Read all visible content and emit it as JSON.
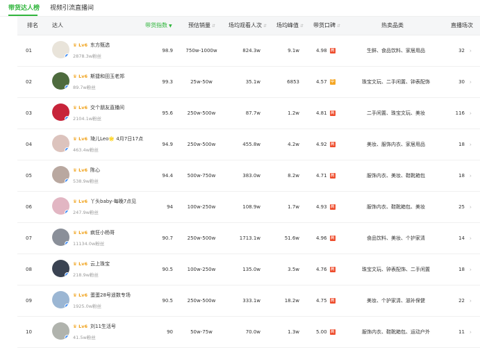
{
  "tabs": [
    {
      "label": "带货达人榜",
      "active": true
    },
    {
      "label": "视频引流直播间",
      "active": false
    }
  ],
  "colors": {
    "accent": "#2fb53b",
    "lv_badge": "#f0a21b",
    "grade_high": "#ee4d2d",
    "grade_mid": "#f5a623",
    "verified_badge": "#3d8df7"
  },
  "headers": {
    "rank": "排名",
    "name": "达人",
    "index": "带货指数",
    "sales": "预估销量",
    "viewers": "场均观看人次",
    "peak": "场均峰值",
    "rating": "带货口碑",
    "category": "热卖品类",
    "sessions": "直播场次"
  },
  "rows": [
    {
      "rank": "01",
      "name": "东方甄选",
      "level": "Lv6",
      "fans": "2878.3w粉丝",
      "index": "98.9",
      "sales": "750w-1000w",
      "viewers": "824.3w",
      "peak": "9.1w",
      "rating": "4.98",
      "grade": "高",
      "grade_color": "#ee4d2d",
      "category": "生鲜、食品饮料、家居用品",
      "sessions": "32",
      "avatar_color": "#e9e4da"
    },
    {
      "rank": "02",
      "name": "斯捷和田玉老郑",
      "level": "Lv6",
      "fans": "89.7w粉丝",
      "index": "99.3",
      "sales": "25w-50w",
      "viewers": "35.1w",
      "peak": "6853",
      "rating": "4.57",
      "grade": "中",
      "grade_color": "#f5a623",
      "category": "珠宝文玩、二手闲置、钟表配饰",
      "sessions": "30",
      "avatar_color": "#4e6b3e"
    },
    {
      "rank": "03",
      "name": "交个朋友直播间",
      "level": "Lv6",
      "fans": "2104.1w粉丝",
      "index": "95.6",
      "sales": "250w-500w",
      "viewers": "87.7w",
      "peak": "1.2w",
      "rating": "4.81",
      "grade": "高",
      "grade_color": "#ee4d2d",
      "category": "二手闲置、珠宝文玩、美妆",
      "sessions": "116",
      "avatar_color": "#c7243a"
    },
    {
      "rank": "04",
      "name": "琦儿Leo🌟 4月7日17点",
      "level": "Lv6",
      "fans": "463.4w粉丝",
      "index": "94.9",
      "sales": "250w-500w",
      "viewers": "455.8w",
      "peak": "4.2w",
      "rating": "4.92",
      "grade": "高",
      "grade_color": "#ee4d2d",
      "category": "美妆、服饰内衣、家居用品",
      "sessions": "18",
      "avatar_color": "#dcc3bd"
    },
    {
      "rank": "05",
      "name": "陈心",
      "level": "Lv6",
      "fans": "538.9w粉丝",
      "index": "94.4",
      "sales": "500w-750w",
      "viewers": "383.0w",
      "peak": "8.2w",
      "rating": "4.71",
      "grade": "高",
      "grade_color": "#ee4d2d",
      "category": "服饰内衣、美妆、鞋靴箱包",
      "sessions": "18",
      "avatar_color": "#b9a8a0"
    },
    {
      "rank": "06",
      "name": "丫头baby-每晚7点见",
      "level": "Lv6",
      "fans": "247.9w粉丝",
      "index": "94",
      "sales": "100w-250w",
      "viewers": "108.9w",
      "peak": "1.7w",
      "rating": "4.93",
      "grade": "高",
      "grade_color": "#ee4d2d",
      "category": "服饰内衣、鞋靴箱包、美妆",
      "sessions": "25",
      "avatar_color": "#e2b6c3"
    },
    {
      "rank": "07",
      "name": "疯狂小杨哥",
      "level": "Lv6",
      "fans": "11134.0w粉丝",
      "index": "90.7",
      "sales": "250w-500w",
      "viewers": "1713.1w",
      "peak": "51.6w",
      "rating": "4.96",
      "grade": "高",
      "grade_color": "#ee4d2d",
      "category": "食品饮料、美妆、个护家清",
      "sessions": "14",
      "avatar_color": "#8a8f99"
    },
    {
      "rank": "08",
      "name": "云上珠宝",
      "level": "Lv6",
      "fans": "218.9w粉丝",
      "index": "90.5",
      "sales": "100w-250w",
      "viewers": "135.0w",
      "peak": "3.5w",
      "rating": "4.76",
      "grade": "高",
      "grade_color": "#ee4d2d",
      "category": "珠宝文玩、钟表配饰、二手闲置",
      "sessions": "18",
      "avatar_color": "#3a4352"
    },
    {
      "rank": "09",
      "name": "蛋蛋28号遥数专场",
      "level": "Lv6",
      "fans": "1925.0w粉丝",
      "index": "90.5",
      "sales": "250w-500w",
      "viewers": "333.1w",
      "peak": "18.2w",
      "rating": "4.75",
      "grade": "高",
      "grade_color": "#ee4d2d",
      "category": "美妆、个护家清、滋补保健",
      "sessions": "22",
      "avatar_color": "#9bb6d3"
    },
    {
      "rank": "10",
      "name": "刘11生活号",
      "level": "Lv6",
      "fans": "41.5w粉丝",
      "index": "90",
      "sales": "50w-75w",
      "viewers": "70.0w",
      "peak": "1.3w",
      "rating": "5.00",
      "grade": "高",
      "grade_color": "#ee4d2d",
      "category": "服饰内衣、鞋靴箱包、运动户外",
      "sessions": "11",
      "avatar_color": "#b0b3ad"
    }
  ]
}
